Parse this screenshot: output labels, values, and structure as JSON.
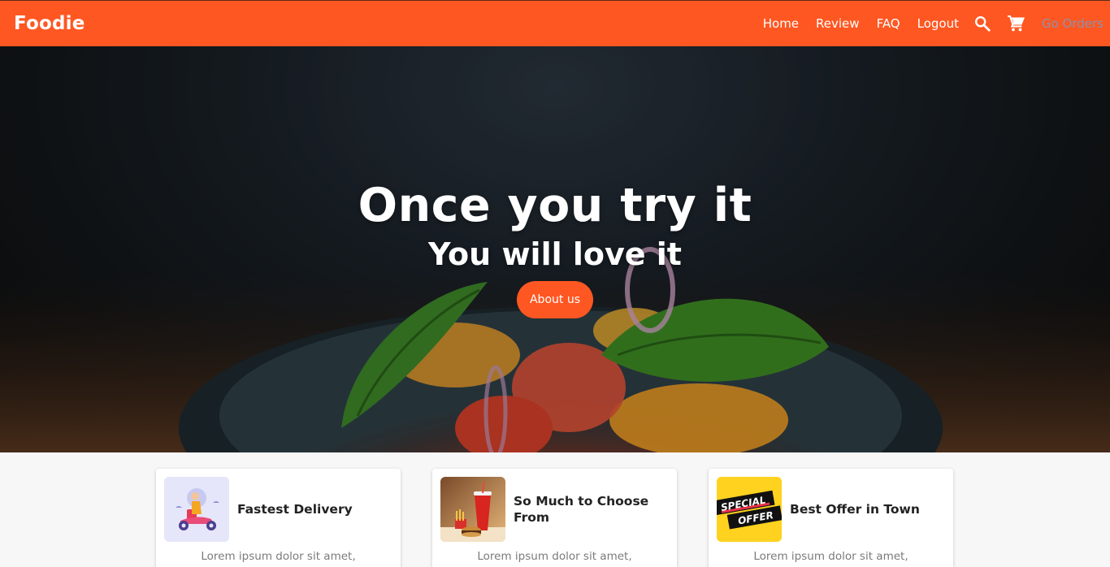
{
  "navbar": {
    "brand": "Foodie",
    "links": [
      "Home",
      "Review",
      "FAQ",
      "Logout"
    ],
    "search_icon": "search-icon",
    "cart_icon": "cart-icon",
    "orders_label": "Go Orders"
  },
  "hero": {
    "title": "Once you try it",
    "subtitle": "You will love it",
    "button_label": "About us"
  },
  "features": [
    {
      "title": "Fastest Delivery",
      "icon": "scooter-delivery-image",
      "text": "Lorem ipsum dolor sit amet,"
    },
    {
      "title": "So Much to Choose From",
      "icon": "fastfood-image",
      "text": "Lorem ipsum dolor sit amet,"
    },
    {
      "title": "Best Offer in Town",
      "icon": "special-offer-image",
      "text": "Lorem ipsum dolor sit amet,"
    }
  ],
  "colors": {
    "accent": "#ff5722",
    "text_dark": "#222222",
    "text_muted": "#7a7a7a",
    "orders_link": "#8d91a8"
  },
  "badge": {
    "line1": "SPECIAL",
    "line2": "OFFER"
  }
}
